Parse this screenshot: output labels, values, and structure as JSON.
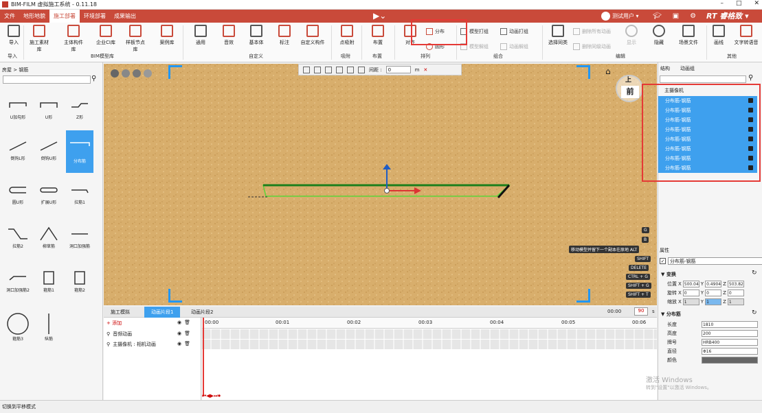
{
  "titlebar": {
    "title": "BIM-FILM 虚拟施工系统 - 0.11.18",
    "minimize": "–",
    "maximize": "□",
    "close": "✕"
  },
  "menubar": {
    "items": [
      "文件",
      "地形地貌",
      "施工部署",
      "环境部署",
      "成果输出"
    ],
    "active_index": 2,
    "play_icon": "▶⌄",
    "user": "测试用户 ▾",
    "brand": "RT 睿格致 ▾",
    "accent_color": "#c94a3a"
  },
  "ribbon": {
    "buttons": {
      "import": "导入",
      "construction_material": "施工素材库",
      "main_component": "主体构件库",
      "enterprise_ci": "企业CI库",
      "sample_node": "样板节点库",
      "case": "案例库",
      "general": "通用",
      "sound": "音效",
      "basic_body": "基本体",
      "annotate": "标注",
      "custom_component": "自定义构件",
      "point_adsorb": "点吸附",
      "layout": "布置",
      "align": "对齐",
      "distribute": "分布",
      "circle": "圆形",
      "model_group": "模型打组",
      "model_ungroup": "模型解组",
      "anim_group": "动画打组",
      "anim_ungroup": "动画解组",
      "select_same": "选择同类",
      "delete_all_anim": "删除所有动画",
      "delete_same_anim": "删除同级动画",
      "show": "显示",
      "hide": "隐藏",
      "scene_file": "场景文件",
      "draw_line": "画线",
      "text_to_speech": "文字转语音"
    },
    "groups": {
      "import": "导入",
      "bim_model_lib": "BIM模型库",
      "custom": "自定义",
      "adsorb": "吸附",
      "layout": "布置",
      "arrange": "排列",
      "combine": "组合",
      "edit": "编辑",
      "other": "其他"
    }
  },
  "leftpanel": {
    "breadcrumb": "房屋 > 钢筋",
    "search_placeholder": "",
    "shapes": [
      "U加勾形",
      "U形",
      "Z形",
      "倒钩L形",
      "倒钩U形",
      "分布筋",
      "圆U形",
      "扩展U形",
      "拉筋1",
      "拉筋2",
      "柳草筋",
      "洞口加强筋",
      "洞口加强筋2",
      "箍筋1",
      "箍筋2",
      "箍筋3",
      "纵筋"
    ],
    "selected_shape": "分布筋"
  },
  "viewport": {
    "toolbar": {
      "spacing_label": "间距 :",
      "spacing_value": "0",
      "unit": "m",
      "close": "✕"
    },
    "cube_top": "上",
    "cube_front": "前",
    "hints": [
      "G",
      "B",
      "移动模型并留下一个副本在原地 ALT",
      "SHIFT",
      "DELETE",
      "CTRL + G",
      "SHIFT + G",
      "SHIFT + T"
    ]
  },
  "timeline": {
    "tabs": [
      "施工模拟",
      "动画片段1",
      "动画片段2"
    ],
    "active_tab": 1,
    "time": "00:00",
    "frame": "90",
    "unit": "s",
    "add": "+ 添加",
    "tracks": [
      "音频动画",
      "主摄像机 : 相机动画"
    ],
    "ticks": [
      "00:00",
      "00:01",
      "00:02",
      "00:03",
      "00:04",
      "00:05",
      "00:06"
    ],
    "controls": "⏮◀▶⏭⏺"
  },
  "rightpanel": {
    "tabs": [
      "结构",
      "动画组"
    ],
    "root": "主摄像机",
    "items": [
      "分布筋-钢筋",
      "分布筋-钢筋",
      "分布筋-钢筋",
      "分布筋-钢筋",
      "分布筋-钢筋",
      "分布筋-钢筋",
      "分布筋-钢筋",
      "分布筋-钢筋"
    ],
    "properties_title": "属性",
    "object_name": "分布筋-钢筋",
    "transform": {
      "title": "▼ 变换",
      "position_label": "位置",
      "rotation_label": "旋转",
      "scale_label": "缩放",
      "position": {
        "x": "500.04",
        "y": "0.4904",
        "z": "503.82"
      },
      "rotation": {
        "x": "0",
        "y": "0",
        "z": "0"
      },
      "scale": {
        "x": "1",
        "y": "1",
        "z": "1"
      }
    },
    "rebar": {
      "title": "▼ 分布筋",
      "length_label": "长度",
      "length": "1810",
      "height_label": "高度",
      "height": "200",
      "grade_label": "牌号",
      "grade": "HRB400",
      "diameter_label": "直径",
      "diameter": "Φ16",
      "color_label": "颜色"
    }
  },
  "watermark": {
    "line1": "激活 Windows",
    "line2": "转到\"设置\"以激活 Windows。"
  },
  "statusbar": {
    "text": "切换到平移模式"
  }
}
